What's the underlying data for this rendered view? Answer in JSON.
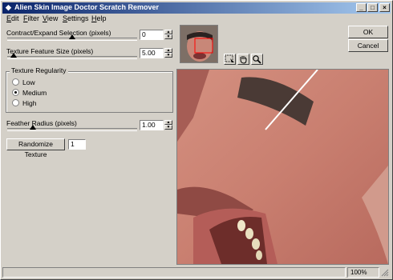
{
  "window": {
    "title": "Alien Skin Image Doctor Scratch Remover"
  },
  "titlebar": {
    "minimize_icon": "minimize-icon",
    "maximize_icon": "maximize-icon",
    "close_icon": "close-icon"
  },
  "menu": [
    {
      "label": "Edit",
      "underline": "E"
    },
    {
      "label": "Filter",
      "underline": "F"
    },
    {
      "label": "View",
      "underline": "V"
    },
    {
      "label": "Settings",
      "underline": "S"
    },
    {
      "label": "Help",
      "underline": "H"
    }
  ],
  "controls": {
    "contract_expand": {
      "label": "Contract/Expand Selection (pixels)",
      "value": "0",
      "fraction": 0.5
    },
    "texture_size": {
      "label": "Texture Feature Size (pixels)",
      "value": "5.00",
      "fraction": 0.05
    },
    "texture_regularity": {
      "title": "Texture Regularity",
      "options": [
        "Low",
        "Medium",
        "High"
      ],
      "selected": "Medium"
    },
    "feather_radius": {
      "label": "Feather Radius (pixels)",
      "value": "1.00",
      "fraction": 0.2
    },
    "randomize": {
      "label": "Randomize Texture",
      "value": "1"
    }
  },
  "buttons": {
    "ok": "OK",
    "cancel": "Cancel"
  },
  "tools": [
    {
      "name": "preview-select-icon"
    },
    {
      "name": "hand-icon"
    },
    {
      "name": "zoom-icon"
    }
  ],
  "status": {
    "zoom": "100%"
  }
}
